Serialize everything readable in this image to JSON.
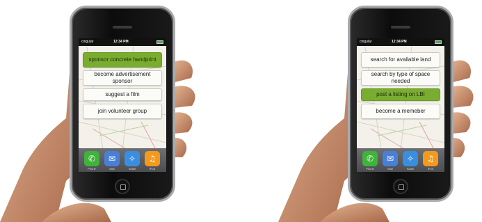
{
  "status": {
    "carrier": "cingular",
    "time": "12:34 PM"
  },
  "left_screen": {
    "buttons": [
      {
        "label": "sponsor concrete handprint"
      },
      {
        "label": "become advertisement sponsor"
      },
      {
        "label": "suggest a film"
      },
      {
        "label": "join volunteer group"
      }
    ]
  },
  "right_screen": {
    "buttons": [
      {
        "label": "search for available land"
      },
      {
        "label": "search by type of space needed"
      },
      {
        "label": "post a listing on LBI"
      },
      {
        "label": "become a memeber"
      }
    ]
  },
  "dock": [
    "Phone",
    "Mail",
    "Safari",
    "iPod"
  ],
  "colors": {
    "active_button": "#79ad2f",
    "skin": "#c98f6e"
  }
}
